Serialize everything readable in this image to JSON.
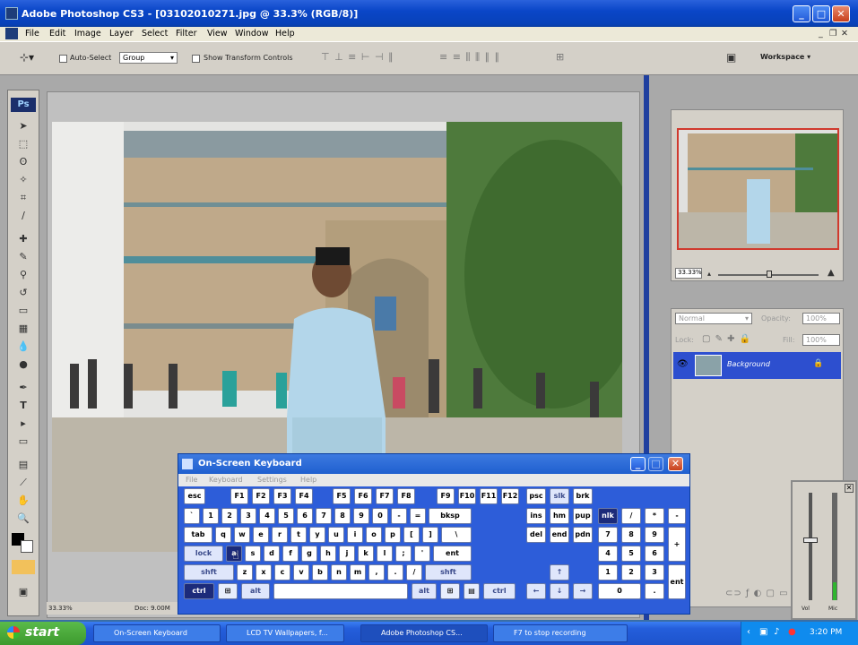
{
  "window": {
    "title": "Adobe Photoshop CS3 - [03102010271.jpg @ 33.3% (RGB/8)]",
    "controls": [
      "_",
      "□",
      "✕"
    ]
  },
  "menu": [
    "File",
    "Edit",
    "Image",
    "Layer",
    "Select",
    "Filter",
    "View",
    "Window",
    "Help"
  ],
  "options": {
    "auto_select_label": "Auto-Select",
    "group_value": "Group",
    "show_transform_label": "Show Transform Controls",
    "workspace_label": "Workspace ▾"
  },
  "toolbox": {
    "badge": "Ps"
  },
  "document": {
    "zoom": "33.33%",
    "doc_info": "Doc: 9.00M"
  },
  "navigator": {
    "zoom": "33.33%"
  },
  "layers": {
    "blend_mode": "Normal",
    "opacity_label": "Opacity:",
    "opacity_value": "100%",
    "lock_label": "Lock:",
    "fill_label": "Fill:",
    "fill_value": "100%",
    "layer_name": "Background"
  },
  "osk": {
    "title": "On-Screen Keyboard",
    "menu": [
      "File",
      "Keyboard",
      "Settings",
      "Help"
    ],
    "rows": [
      [
        "esc",
        "F1",
        "F2",
        "F3",
        "F4",
        "F5",
        "F6",
        "F7",
        "F8",
        "F9",
        "F10",
        "F11",
        "F12",
        "psc",
        "slk",
        "brk"
      ],
      [
        "`",
        "1",
        "2",
        "3",
        "4",
        "5",
        "6",
        "7",
        "8",
        "9",
        "0",
        "-",
        "=",
        "bksp",
        "ins",
        "hm",
        "pup",
        "nlk",
        "/",
        "*",
        "-"
      ],
      [
        "tab",
        "q",
        "w",
        "e",
        "r",
        "t",
        "y",
        "u",
        "i",
        "o",
        "p",
        "[",
        "]",
        "\\",
        "del",
        "end",
        "pdn",
        "7",
        "8",
        "9",
        "+"
      ],
      [
        "lock",
        "a",
        "s",
        "d",
        "f",
        "g",
        "h",
        "j",
        "k",
        "l",
        ";",
        "'",
        "ent",
        "4",
        "5",
        "6"
      ],
      [
        "shft",
        "z",
        "x",
        "c",
        "v",
        "b",
        "n",
        "m",
        ",",
        ".",
        "/",
        "shft",
        "↑",
        "1",
        "2",
        "3",
        "ent"
      ],
      [
        "ctrl",
        "alt",
        "alt",
        "ctrl",
        "←",
        "↓",
        "→",
        "0",
        "."
      ]
    ]
  },
  "taskbar": {
    "start": "start",
    "tasks": [
      "On-Screen Keyboard",
      "LCD TV Wallpapers, f...",
      "Adobe Photoshop CS...",
      "F7 to stop recording"
    ],
    "clock": "3:20 PM"
  },
  "mixer": {
    "labels": [
      "Vol",
      "Mic"
    ]
  }
}
